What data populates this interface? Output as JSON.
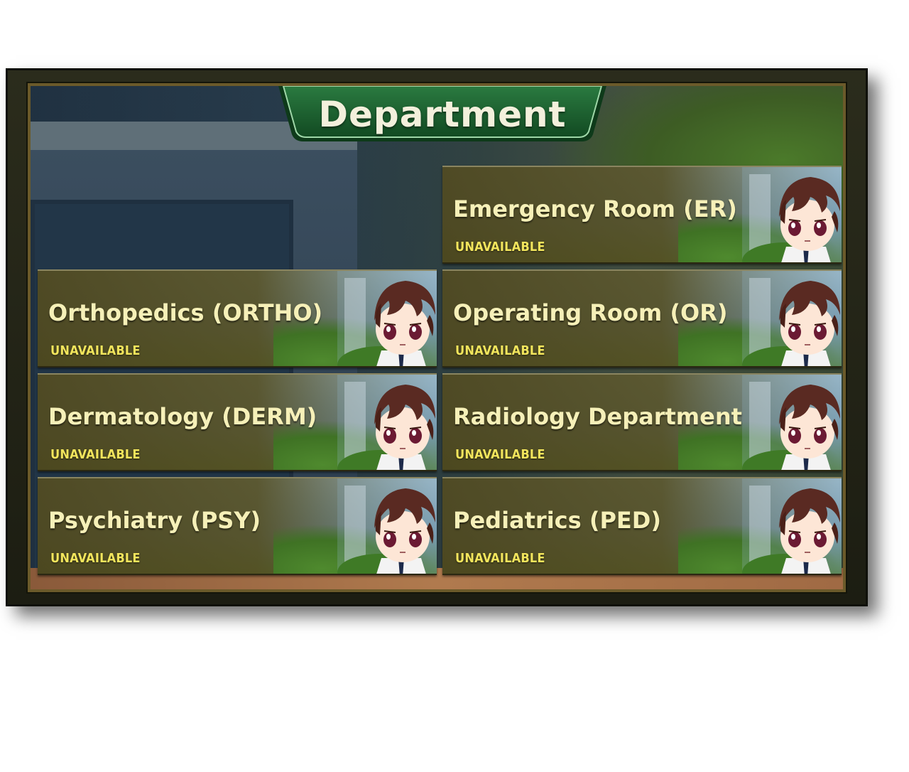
{
  "header": {
    "title": "Department"
  },
  "departments": [
    {
      "name": "Emergency Room (ER)",
      "status": "UNAVAILABLE"
    },
    {
      "name": "Orthopedics (ORTHO)",
      "status": "UNAVAILABLE"
    },
    {
      "name": "Operating Room (OR)",
      "status": "UNAVAILABLE"
    },
    {
      "name": "Dermatology (DERM)",
      "status": "UNAVAILABLE"
    },
    {
      "name": "Radiology Department",
      "status": "UNAVAILABLE"
    },
    {
      "name": "Psychiatry (PSY)",
      "status": "UNAVAILABLE"
    },
    {
      "name": "Pediatrics (PED)",
      "status": "UNAVAILABLE"
    }
  ],
  "colors": {
    "title_plate": "#1e5a2e",
    "name_text": "#f6f0b8",
    "status_text": "#f2e55c",
    "card_base": "#545022"
  }
}
